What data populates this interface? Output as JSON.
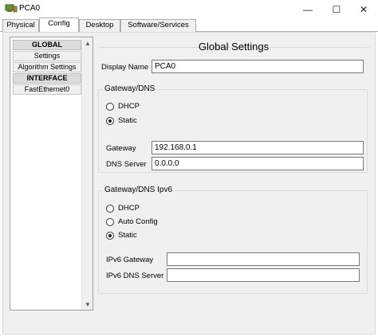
{
  "window": {
    "title": "PCA0",
    "minimize": "—",
    "maximize": "☐",
    "close": "✕"
  },
  "tabs": [
    {
      "label": "Physical",
      "active": false
    },
    {
      "label": "Config",
      "active": true
    },
    {
      "label": "Desktop",
      "active": false
    },
    {
      "label": "Software/Services",
      "active": false
    }
  ],
  "sidebar": {
    "items": [
      {
        "label": "GLOBAL",
        "header": true
      },
      {
        "label": "Settings",
        "header": false
      },
      {
        "label": "Algorithm Settings",
        "header": false
      },
      {
        "label": "INTERFACE",
        "header": true
      },
      {
        "label": "FastEthernet0",
        "header": false
      }
    ]
  },
  "global_settings": {
    "title": "Global Settings",
    "display_name_label": "Display Name",
    "display_name_value": "PCA0"
  },
  "gateway_dns": {
    "title": "Gateway/DNS",
    "dhcp_label": "DHCP",
    "static_label": "Static",
    "selected": "Static",
    "gateway_label": "Gateway",
    "gateway_value": "192.168.0.1",
    "dns_label": "DNS Server",
    "dns_value": "0.0.0.0"
  },
  "gateway_dns_ipv6": {
    "title": "Gateway/DNS Ipv6",
    "dhcp_label": "DHCP",
    "auto_label": "Auto Config",
    "static_label": "Static",
    "selected": "Static",
    "gateway_label": "IPv6 Gateway",
    "gateway_value": "",
    "dns_label": "IPv6 DNS Server",
    "dns_value": ""
  }
}
